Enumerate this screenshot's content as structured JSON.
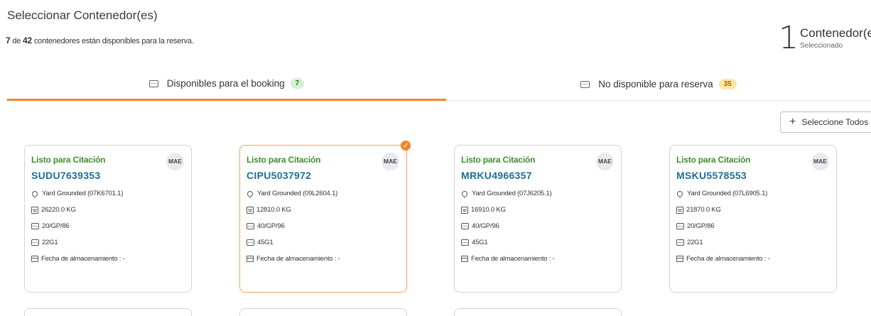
{
  "header": {
    "title": "Seleccionar Contenedor(es)",
    "available_count": "7",
    "connector": "de",
    "total_count": "42",
    "availability_text": "contenedores están disponibles para la reserva."
  },
  "selection": {
    "count": "1",
    "label": "Contenedor(es)",
    "sub_label": "Seleccionado"
  },
  "tabs": [
    {
      "label": "Disponibles para el booking",
      "badge": "7",
      "icon": "container-icon",
      "active": true
    },
    {
      "label": "No disponible para reserva",
      "badge": "35",
      "icon": "container-icon",
      "active": false
    }
  ],
  "select_all_button": {
    "label": "Seleccione Todos",
    "icon": "plus-icon"
  },
  "cards": [
    {
      "status": "Listo para Citación",
      "carrier": "MAE",
      "container_id": "SUDU7639353",
      "location": "Yard Grounded (07K6701.1)",
      "weight": "26220.0 KG",
      "size_type": "20/GP/86",
      "iso_code": "22G1",
      "storage_date": "Fecha de almacenamiento : -",
      "selected": false
    },
    {
      "status": "Listo para Citación",
      "carrier": "MAE",
      "container_id": "CIPU5037972",
      "location": "Yard Grounded (09L2604.1)",
      "weight": "12810.0 KG",
      "size_type": "40/GP/96",
      "iso_code": "45G1",
      "storage_date": "Fecha de almacenamiento : -",
      "selected": true
    },
    {
      "status": "Listo para Citación",
      "carrier": "MAE",
      "container_id": "MRKU4966357",
      "location": "Yard Grounded (07J6205.1)",
      "weight": "16910.0 KG",
      "size_type": "40/GP/96",
      "iso_code": "45G1",
      "storage_date": "Fecha de almacenamiento : -",
      "selected": false
    },
    {
      "status": "Listo para Citación",
      "carrier": "MAE",
      "container_id": "MSKU5578553",
      "location": "Yard Grounded (07L6905.1)",
      "weight": "21870.0 KG",
      "size_type": "20/GP/86",
      "iso_code": "22G1",
      "storage_date": "Fecha de almacenamiento : -",
      "selected": false
    }
  ],
  "colors": {
    "accent": "#f5832b",
    "status_green": "#3e8e2c",
    "container_id_blue": "#1b6f96"
  }
}
